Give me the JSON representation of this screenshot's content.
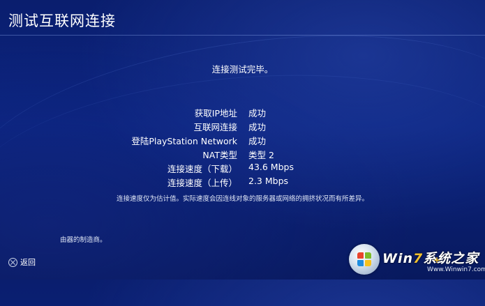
{
  "header": {
    "title": "测试互联网连接"
  },
  "status": {
    "message": "连接测试完毕。"
  },
  "results": [
    {
      "label": "获取IP地址",
      "value": "成功"
    },
    {
      "label": "互联网连接",
      "value": "成功"
    },
    {
      "label": "登陆PlayStation Network",
      "value": "成功"
    },
    {
      "label": "NAT类型",
      "value": "类型 2"
    },
    {
      "label": "连接速度（下载）",
      "value": "43.6 Mbps"
    },
    {
      "label": "连接速度（上传）",
      "value": "2.3 Mbps"
    }
  ],
  "note": "连接速度仅为估计值。实际速度会因连线对象的服务器或网络的拥挤状况而有所差异。",
  "partial_note": "由器的制造商。",
  "footer": {
    "back_label": "返回",
    "back_icon": "cross-button-icon"
  },
  "watermark": {
    "brand_w": "Wi",
    "brand_n": "n",
    "brand_seven": "7",
    "brand_rest": "系统之家",
    "url": "Www.Winwin7.com"
  },
  "colors": {
    "background": "#0b2480",
    "accent": "#f0c030"
  }
}
